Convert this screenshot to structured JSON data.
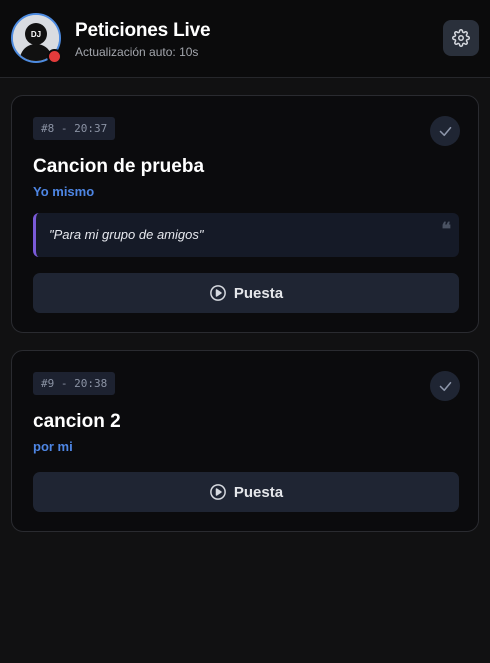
{
  "header": {
    "title": "Peticiones Live",
    "subtitle": "Actualización auto: 10s",
    "avatar_text": "DJ",
    "settings_icon": "gear-icon",
    "live_status_color": "#e23b3b"
  },
  "requests": [
    {
      "badge": "#8 - 20:37",
      "title": "Cancion de prueba",
      "requester": "Yo mismo",
      "message": "\"Para mi grupo de amigos\"",
      "quote_glyph": "❝",
      "action_label": "Puesta",
      "action_icon": "play-circle-icon",
      "check_icon": "check-icon"
    },
    {
      "badge": "#9 - 20:38",
      "title": "cancion 2",
      "requester": "por mi",
      "action_label": "Puesta",
      "action_icon": "play-circle-icon",
      "check_icon": "check-icon"
    }
  ],
  "colors": {
    "accent_blue": "#4e86e4",
    "message_border": "#7a5ad8"
  }
}
